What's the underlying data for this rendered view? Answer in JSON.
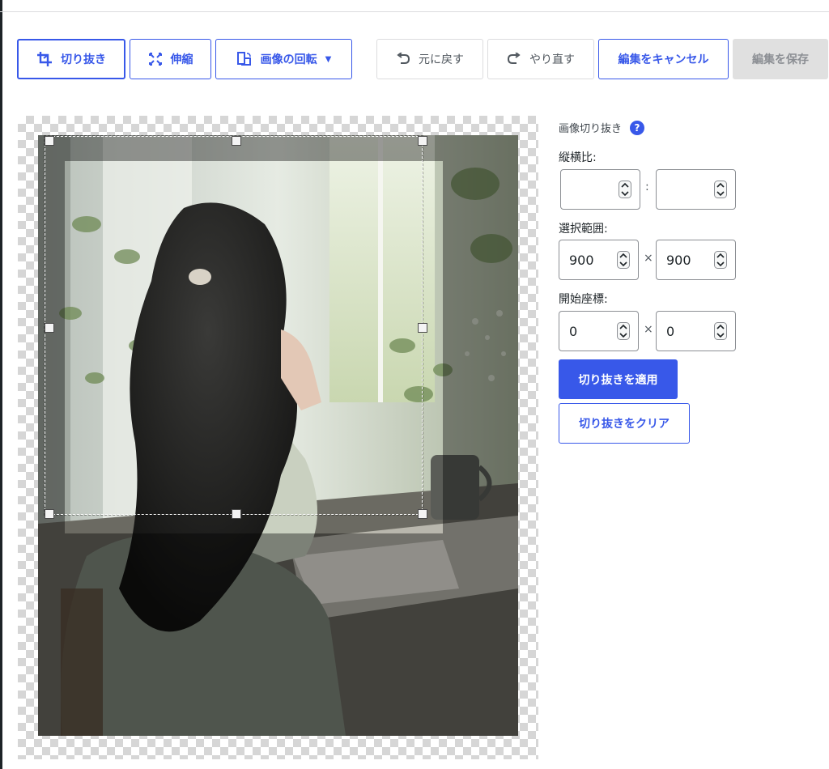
{
  "toolbar": {
    "crop_label": "切り抜き",
    "scale_label": "伸縮",
    "rotate_label": "画像の回転",
    "undo_label": "元に戻す",
    "redo_label": "やり直す",
    "cancel_label": "編集をキャンセル",
    "save_label": "編集を保存"
  },
  "crop_panel": {
    "title": "画像切り抜き",
    "help_glyph": "?",
    "aspect_ratio_label": "縦横比:",
    "aspect_width": "",
    "aspect_height": "",
    "aspect_separator": ":",
    "selection_label": "選択範囲:",
    "selection_width": "900",
    "selection_height": "900",
    "dimension_separator": "×",
    "start_label": "開始座標:",
    "start_x": "0",
    "start_y": "0",
    "apply_label": "切り抜きを適用",
    "clear_label": "切り抜きをクリア"
  },
  "icons": {
    "crop": "crop-icon",
    "scale": "scale-arrows-icon",
    "rotate": "rotate-icon",
    "undo": "undo-arrow-icon",
    "redo": "redo-arrow-icon",
    "help": "help-question-icon",
    "spinner": "spinner-arrows-icon"
  },
  "colors": {
    "accent": "#3858e9",
    "disabled_bg": "#e0e0e0",
    "border_muted": "#dcdcde"
  }
}
